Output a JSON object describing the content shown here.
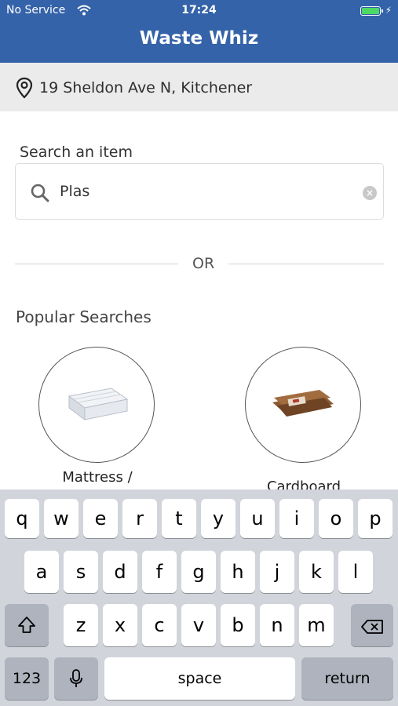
{
  "status_bar": {
    "carrier": "No Service",
    "time": "17:24"
  },
  "app": {
    "title": "Waste Whiz"
  },
  "location": {
    "address": "19 Sheldon Ave N, Kitchener"
  },
  "search": {
    "label": "Search an item",
    "value": "Plas",
    "clear": "×"
  },
  "divider": {
    "text": "OR"
  },
  "popular": {
    "heading": "Popular Searches",
    "items": [
      {
        "caption": "Mattress /"
      },
      {
        "caption": "Cardboard"
      }
    ]
  },
  "keyboard": {
    "row1": [
      "q",
      "w",
      "e",
      "r",
      "t",
      "y",
      "u",
      "i",
      "o",
      "p"
    ],
    "row2": [
      "a",
      "s",
      "d",
      "f",
      "g",
      "h",
      "j",
      "k",
      "l"
    ],
    "row3": [
      "z",
      "x",
      "c",
      "v",
      "b",
      "n",
      "m"
    ],
    "numbers_key": "123",
    "space_key": "space",
    "return_key": "return"
  },
  "colors": {
    "header": "#3563a9",
    "battery": "#4cd964",
    "keyboard_bg": "#d1d4da"
  }
}
